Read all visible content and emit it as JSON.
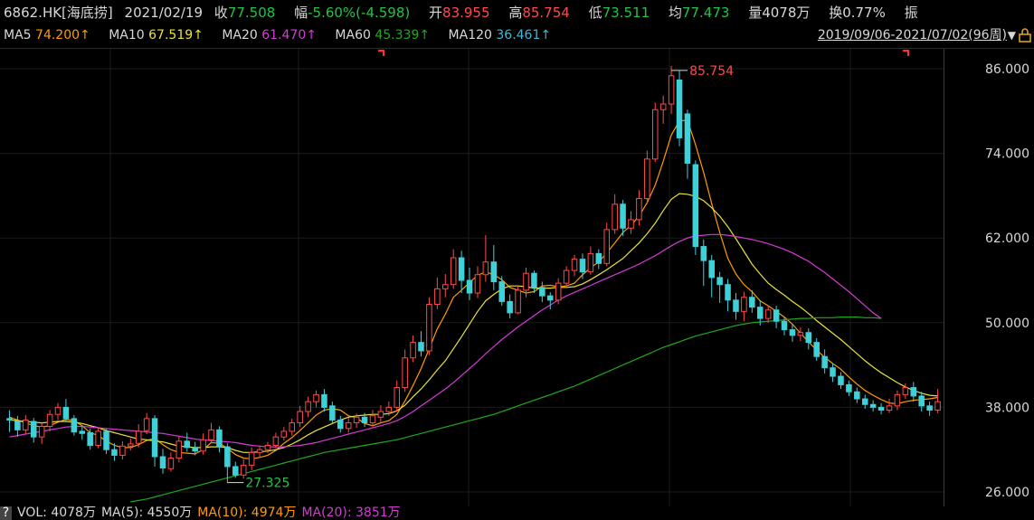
{
  "header": {
    "code": "6862.HK[海底捞]",
    "date": "2021/02/19",
    "close_label": "收",
    "close": "77.508",
    "change_label": "幅",
    "change": "-5.60%(-4.598)",
    "open_label": "开",
    "open": "83.955",
    "high_label": "高",
    "high": "85.754",
    "low_label": "低",
    "low": "73.511",
    "avg_label": "均",
    "avg": "77.473",
    "volume_label": "量",
    "volume": "4078万",
    "turnover_label": "换",
    "turnover": "0.77%",
    "amplitude_label": "振"
  },
  "ma_row": {
    "ma5_label": "MA5",
    "ma5": "74.200↑",
    "ma10_label": "MA10",
    "ma10": "67.519↑",
    "ma20_label": "MA20",
    "ma20": "61.470↑",
    "ma60_label": "MA60",
    "ma60": "45.339↑",
    "ma120_label": "MA120",
    "ma120": "36.461↑",
    "range": "2019/09/06-2021/07/02(96周)",
    "range_arrow": "▼"
  },
  "volume_row": {
    "help": "?",
    "vol": "VOL: 4078万",
    "ma5": "MA(5): 4550万",
    "ma10": "MA(10): 4974万",
    "ma20": "MA(20): 3851万"
  },
  "colors": {
    "up": "#ff4a4a",
    "down": "#3fd0d8",
    "ma5": "#ff9c00",
    "ma10": "#e8e23a",
    "ma20": "#d53ad5",
    "ma60": "#1fa81f",
    "ma120": "#3fb8d8",
    "axis": "#d8d8d8"
  },
  "chart_data": {
    "type": "candlestick",
    "period": "weekly",
    "ylim": [
      26,
      86
    ],
    "yticks": [
      "86.000",
      "74.000",
      "62.000",
      "50.000",
      "38.000",
      "26.000"
    ],
    "ytick_values": [
      86,
      74,
      62,
      50,
      38,
      26
    ],
    "max_label": "85.754",
    "min_label": "27.325",
    "candles": [
      [
        36.4,
        36.2,
        37.6,
        34.5
      ],
      [
        36.0,
        34.8,
        36.8,
        33.8
      ],
      [
        34.8,
        36.2,
        36.9,
        34.2
      ],
      [
        36.0,
        33.8,
        36.5,
        33.0
      ],
      [
        33.8,
        35.3,
        35.8,
        32.8
      ],
      [
        35.3,
        37.0,
        37.6,
        34.6
      ],
      [
        37.0,
        38.0,
        38.6,
        36.2
      ],
      [
        38.0,
        36.4,
        39.2,
        35.9
      ],
      [
        36.4,
        34.5,
        36.9,
        34.0
      ],
      [
        34.6,
        34.3,
        35.4,
        33.4
      ],
      [
        34.4,
        32.6,
        35.0,
        32.0
      ],
      [
        32.6,
        34.6,
        35.2,
        32.2
      ],
      [
        34.6,
        32.0,
        34.9,
        31.4
      ],
      [
        32.0,
        31.2,
        32.9,
        30.4
      ],
      [
        31.2,
        32.5,
        33.2,
        30.6
      ],
      [
        32.5,
        32.8,
        33.6,
        31.9
      ],
      [
        32.9,
        34.6,
        35.6,
        32.3
      ],
      [
        34.7,
        36.4,
        37.2,
        34.2
      ],
      [
        36.4,
        31.0,
        36.9,
        29.6
      ],
      [
        31.0,
        29.4,
        32.1,
        28.6
      ],
      [
        29.3,
        30.8,
        31.6,
        28.9
      ],
      [
        30.8,
        33.2,
        34.0,
        30.2
      ],
      [
        33.2,
        32.3,
        34.4,
        31.7
      ],
      [
        32.3,
        31.8,
        33.1,
        31.2
      ],
      [
        31.8,
        33.4,
        34.3,
        31.3
      ],
      [
        33.4,
        34.8,
        35.8,
        33.0
      ],
      [
        34.8,
        32.4,
        35.3,
        31.6
      ],
      [
        32.4,
        29.6,
        32.9,
        27.3
      ],
      [
        29.6,
        28.4,
        30.3,
        28.0
      ],
      [
        28.4,
        29.8,
        30.6,
        27.9
      ],
      [
        29.8,
        31.6,
        32.3,
        29.1
      ],
      [
        31.6,
        32.0,
        32.6,
        31.0
      ],
      [
        32.0,
        32.6,
        33.1,
        31.5
      ],
      [
        32.6,
        33.8,
        34.4,
        32.2
      ],
      [
        33.8,
        34.6,
        35.2,
        33.3
      ],
      [
        34.6,
        35.8,
        36.4,
        34.0
      ],
      [
        35.8,
        37.4,
        38.2,
        35.2
      ],
      [
        37.4,
        38.8,
        39.5,
        36.6
      ],
      [
        38.8,
        39.8,
        40.4,
        38.0
      ],
      [
        39.8,
        38.0,
        40.6,
        37.4
      ],
      [
        38.2,
        36.2,
        38.8,
        35.6
      ],
      [
        36.2,
        35.0,
        36.8,
        34.4
      ],
      [
        35.0,
        35.8,
        36.5,
        34.4
      ],
      [
        35.8,
        36.6,
        37.1,
        35.1
      ],
      [
        36.6,
        35.8,
        37.2,
        35.2
      ],
      [
        35.8,
        36.8,
        37.6,
        35.4
      ],
      [
        36.6,
        37.4,
        38.3,
        35.9
      ],
      [
        37.4,
        38.0,
        38.8,
        36.8
      ],
      [
        38.0,
        40.8,
        41.8,
        37.4
      ],
      [
        40.8,
        45.0,
        46.2,
        40.2
      ],
      [
        45.0,
        47.2,
        48.2,
        44.4
      ],
      [
        47.2,
        46.0,
        48.8,
        45.2
      ],
      [
        46.0,
        52.6,
        53.6,
        45.4
      ],
      [
        52.6,
        54.8,
        56.4,
        51.9
      ],
      [
        54.8,
        55.4,
        56.9,
        53.6
      ],
      [
        55.4,
        59.2,
        60.4,
        54.8
      ],
      [
        59.2,
        56.0,
        60.2,
        54.2
      ],
      [
        56.0,
        54.2,
        57.8,
        53.2
      ],
      [
        54.2,
        56.8,
        58.0,
        53.5
      ],
      [
        56.8,
        58.6,
        62.4,
        55.8
      ],
      [
        58.6,
        55.8,
        61.0,
        54.6
      ],
      [
        55.8,
        53.0,
        56.6,
        52.4
      ],
      [
        53.0,
        51.4,
        54.0,
        50.6
      ],
      [
        51.4,
        54.6,
        55.2,
        51.2
      ],
      [
        54.6,
        57.0,
        57.8,
        53.6
      ],
      [
        57.0,
        55.0,
        57.4,
        54.2
      ],
      [
        55.0,
        53.8,
        55.8,
        52.9
      ],
      [
        53.8,
        53.2,
        54.3,
        51.9
      ],
      [
        53.2,
        55.6,
        56.3,
        52.6
      ],
      [
        55.6,
        57.4,
        58.0,
        55.0
      ],
      [
        57.4,
        59.0,
        59.6,
        56.6
      ],
      [
        59.0,
        57.2,
        59.8,
        56.2
      ],
      [
        57.2,
        59.8,
        60.8,
        56.8
      ],
      [
        59.8,
        58.4,
        60.4,
        57.6
      ],
      [
        58.4,
        63.2,
        64.2,
        58.0
      ],
      [
        63.2,
        66.8,
        68.2,
        62.6
      ],
      [
        66.8,
        63.4,
        67.4,
        62.3
      ],
      [
        63.4,
        64.6,
        65.8,
        62.6
      ],
      [
        64.6,
        67.6,
        68.8,
        63.8
      ],
      [
        67.6,
        73.2,
        74.4,
        66.8
      ],
      [
        73.2,
        80.2,
        81.2,
        72.8
      ],
      [
        80.2,
        81.0,
        82.2,
        78.2
      ],
      [
        81.0,
        85.0,
        86.4,
        79.6
      ],
      [
        84.4,
        76.2,
        85.8,
        75.0
      ],
      [
        79.6,
        72.6,
        80.2,
        70.4
      ],
      [
        72.4,
        60.8,
        73.0,
        59.6
      ],
      [
        60.8,
        58.8,
        61.8,
        55.2
      ],
      [
        58.8,
        56.4,
        59.6,
        53.6
      ],
      [
        56.4,
        55.4,
        57.2,
        52.8
      ],
      [
        55.4,
        53.2,
        56.2,
        51.6
      ],
      [
        53.2,
        51.6,
        54.2,
        50.4
      ],
      [
        51.6,
        53.6,
        54.4,
        50.2
      ],
      [
        53.6,
        52.2,
        54.6,
        51.4
      ],
      [
        52.2,
        50.6,
        53.2,
        49.6
      ],
      [
        50.6,
        51.8,
        52.4,
        50.0
      ],
      [
        51.8,
        50.2,
        52.4,
        49.2
      ],
      [
        50.2,
        49.0,
        50.8,
        48.2
      ],
      [
        49.0,
        48.2,
        49.8,
        47.3
      ],
      [
        48.2,
        48.6,
        49.3,
        47.4
      ],
      [
        48.6,
        47.2,
        49.2,
        46.2
      ],
      [
        47.2,
        45.2,
        47.8,
        44.6
      ],
      [
        45.2,
        43.6,
        46.2,
        42.8
      ],
      [
        43.6,
        42.4,
        44.2,
        41.6
      ],
      [
        42.4,
        41.2,
        43.0,
        40.6
      ],
      [
        41.2,
        40.2,
        41.8,
        39.6
      ],
      [
        40.2,
        39.2,
        40.8,
        38.6
      ],
      [
        39.2,
        38.4,
        39.8,
        37.8
      ],
      [
        38.4,
        38.0,
        39.0,
        37.4
      ],
      [
        38.0,
        37.6,
        38.6,
        37.0
      ],
      [
        37.6,
        38.2,
        39.2,
        37.2
      ],
      [
        38.2,
        39.8,
        40.4,
        37.6
      ],
      [
        39.8,
        40.8,
        41.4,
        39.2
      ],
      [
        40.8,
        39.6,
        41.6,
        38.8
      ],
      [
        39.6,
        38.2,
        40.2,
        37.4
      ],
      [
        38.2,
        37.6,
        38.8,
        36.8
      ],
      [
        37.6,
        38.8,
        40.6,
        37.2
      ]
    ],
    "ma_series": [
      {
        "name": "MA5",
        "color": "#ff9c00",
        "values": [
          36.6,
          36.2,
          35.8,
          35.4,
          35.2,
          35.4,
          35.9,
          36.3,
          36.1,
          35.4,
          34.4,
          34.0,
          33.2,
          32.6,
          32.3,
          32.3,
          32.7,
          33.3,
          33.6,
          32.7,
          32.0,
          31.6,
          31.5,
          31.4,
          32.0,
          33.0,
          32.9,
          32.2,
          31.3,
          30.8,
          30.7,
          30.9,
          31.2,
          31.9,
          32.9,
          33.7,
          34.7,
          35.8,
          36.9,
          37.6,
          37.8,
          37.6,
          36.8,
          36.5,
          35.7,
          35.4,
          35.8,
          36.1,
          37.0,
          38.9,
          41.1,
          43.5,
          46.3,
          49.1,
          51.2,
          53.6,
          54.6,
          55.7,
          56.7,
          57.2,
          56.8,
          56.1,
          55.0,
          54.6,
          54.2,
          54.4,
          55.2,
          55.3,
          55.1,
          55.2,
          55.6,
          56.8,
          57.8,
          58.6,
          59.9,
          61.3,
          62.8,
          63.8,
          65.1,
          67.0,
          69.5,
          72.9,
          76.6,
          78.6,
          78.7,
          75.2,
          71.3,
          66.9,
          62.8,
          59.1,
          56.9,
          55.4,
          54.4,
          53.1,
          52.4,
          51.6,
          50.8,
          49.8,
          48.5,
          47.3,
          46.1,
          45.1,
          44.2,
          43.4,
          42.3,
          41.3,
          40.4,
          39.7,
          39.1,
          38.6,
          38.5,
          38.8,
          39.0,
          39.1,
          39.2,
          39.4
        ]
      },
      {
        "name": "MA10",
        "color": "#e8e23a",
        "values": [
          36.2,
          36.1,
          36.0,
          35.9,
          35.8,
          35.9,
          36.0,
          36.0,
          35.9,
          35.7,
          35.4,
          35.1,
          34.7,
          34.4,
          34.1,
          33.8,
          33.5,
          33.4,
          33.2,
          33.1,
          32.8,
          32.5,
          32.4,
          32.3,
          32.3,
          32.4,
          32.4,
          32.3,
          31.9,
          31.6,
          31.6,
          31.7,
          31.8,
          32.0,
          32.3,
          32.8,
          33.4,
          34.1,
          34.7,
          35.2,
          35.7,
          36.2,
          36.6,
          36.8,
          36.9,
          37.0,
          37.0,
          37.1,
          37.5,
          38.3,
          39.5,
          40.6,
          41.9,
          43.3,
          44.6,
          46.3,
          48.0,
          49.8,
          51.6,
          53.1,
          54.0,
          54.8,
          55.2,
          55.2,
          55.1,
          54.9,
          54.9,
          54.9,
          55.0,
          55.0,
          55.1,
          55.5,
          56.1,
          56.8,
          57.5,
          58.3,
          59.1,
          60.2,
          61.3,
          62.6,
          64.1,
          65.9,
          67.5,
          68.3,
          68.2,
          67.9,
          67.3,
          66.3,
          65.1,
          63.6,
          61.9,
          60.1,
          58.3,
          56.9,
          55.6,
          54.7,
          53.9,
          53.0,
          52.2,
          51.3,
          50.3,
          49.4,
          48.5,
          47.6,
          46.6,
          45.6,
          44.6,
          43.7,
          42.9,
          42.2,
          41.5,
          40.9,
          40.4,
          40.0,
          39.7,
          39.6
        ]
      },
      {
        "name": "MA20",
        "color": "#d53ad5",
        "values": [
          33.8,
          34.0,
          34.2,
          34.4,
          34.6,
          34.8,
          35.0,
          35.2,
          35.3,
          35.3,
          35.2,
          35.1,
          35.0,
          34.9,
          34.8,
          34.7,
          34.6,
          34.5,
          34.4,
          34.3,
          34.1,
          33.9,
          33.7,
          33.5,
          33.4,
          33.3,
          33.2,
          33.1,
          33.0,
          32.8,
          32.6,
          32.5,
          32.4,
          32.4,
          32.4,
          32.5,
          32.6,
          32.8,
          33.0,
          33.3,
          33.6,
          33.9,
          34.2,
          34.5,
          34.8,
          35.1,
          35.4,
          35.7,
          36.1,
          36.7,
          37.4,
          38.2,
          39.0,
          39.8,
          40.6,
          41.5,
          42.5,
          43.5,
          44.5,
          45.6,
          46.6,
          47.6,
          48.5,
          49.4,
          50.2,
          51.0,
          51.8,
          52.5,
          53.2,
          53.8,
          54.3,
          54.8,
          55.3,
          55.8,
          56.3,
          56.8,
          57.3,
          57.8,
          58.3,
          58.9,
          59.5,
          60.2,
          60.9,
          61.5,
          62.0,
          62.3,
          62.4,
          62.5,
          62.5,
          62.4,
          62.2,
          62.0,
          61.8,
          61.5,
          61.2,
          60.8,
          60.4,
          59.9,
          59.3,
          58.7,
          57.9,
          57.1,
          56.2,
          55.3,
          54.4,
          53.4,
          52.4,
          51.4,
          50.6
        ]
      },
      {
        "name": "MA60",
        "color": "#1fa81f",
        "values": [
          null,
          null,
          null,
          null,
          null,
          null,
          null,
          null,
          null,
          null,
          null,
          null,
          null,
          null,
          null,
          24.6,
          24.8,
          25.0,
          25.3,
          25.6,
          25.9,
          26.2,
          26.5,
          26.8,
          27.1,
          27.4,
          27.7,
          28.0,
          28.3,
          28.6,
          28.9,
          29.2,
          29.5,
          29.8,
          30.1,
          30.4,
          30.7,
          31.0,
          31.3,
          31.6,
          31.8,
          32.0,
          32.2,
          32.4,
          32.6,
          32.8,
          33.0,
          33.2,
          33.4,
          33.7,
          34.0,
          34.3,
          34.6,
          34.9,
          35.2,
          35.5,
          35.8,
          36.1,
          36.4,
          36.7,
          37.0,
          37.4,
          37.8,
          38.2,
          38.6,
          39.0,
          39.4,
          39.8,
          40.2,
          40.6,
          41.0,
          41.5,
          42.0,
          42.5,
          43.0,
          43.5,
          44.0,
          44.5,
          45.0,
          45.5,
          46.0,
          46.5,
          46.9,
          47.3,
          47.7,
          48.1,
          48.4,
          48.7,
          49.0,
          49.3,
          49.6,
          49.8,
          50.0,
          50.1,
          50.2,
          50.3,
          50.4,
          50.5,
          50.6,
          50.6,
          50.7,
          50.7,
          50.7,
          50.8,
          50.8,
          50.8,
          50.7,
          50.7,
          50.6
        ]
      },
      {
        "name": "MA120",
        "color": "#3fb8d8",
        "values": [
          null,
          null,
          null,
          null,
          null,
          null,
          null,
          null,
          null,
          null,
          null,
          null,
          null,
          null,
          null,
          null,
          null,
          null,
          null,
          null,
          null,
          null,
          null,
          null,
          null,
          null,
          null,
          null,
          null,
          null,
          null,
          null,
          null,
          null,
          null,
          null,
          null,
          null,
          null,
          null,
          null,
          null,
          null,
          null,
          null,
          null,
          null,
          null,
          null,
          null,
          null,
          null,
          null,
          null,
          null,
          null,
          null,
          null,
          null,
          null,
          null,
          null,
          null,
          null,
          null,
          null,
          null,
          null,
          null,
          null,
          null,
          null,
          null,
          null,
          null,
          null,
          null,
          null,
          null,
          null,
          null,
          null,
          null,
          null,
          null,
          null,
          null,
          null,
          null,
          null,
          null,
          null,
          null,
          null,
          null,
          null,
          null,
          null,
          null,
          null,
          null,
          null,
          null,
          null,
          null,
          null,
          null,
          null,
          null,
          null,
          null,
          null,
          null,
          null
        ]
      }
    ]
  }
}
